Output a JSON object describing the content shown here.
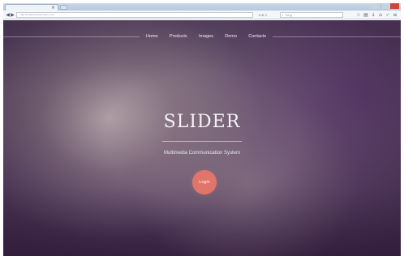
{
  "browser": {
    "tab_close": "×",
    "url": "http://localhost/slider/index.html",
    "search_placeholder": "Bing",
    "url_tools": "▾ ⊗ C",
    "back_icon": "◀",
    "forward_icon": "▶"
  },
  "nav": {
    "items": [
      "Home",
      "Products",
      "Images",
      "Demo",
      "Contacts"
    ]
  },
  "hero": {
    "title": "SLIDER",
    "subtitle": "Multimedia Communication System",
    "login_label": "Login"
  },
  "colors": {
    "accent": "#e0756a",
    "background_dark": "#3b2546",
    "background_light": "#b2a2a6"
  }
}
